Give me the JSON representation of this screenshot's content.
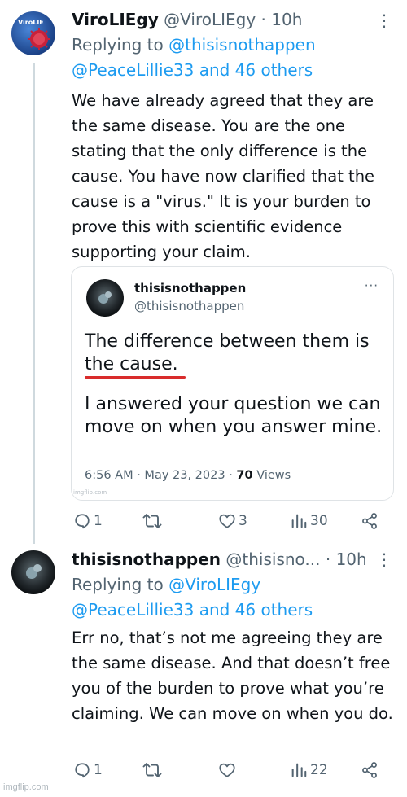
{
  "tweet1": {
    "name": "ViroLIEgy",
    "handle": "@ViroLIEgy",
    "time": "· 10h",
    "avatar_text": "ViroLIE",
    "replying_prefix": "Replying to ",
    "replying_user": "@thisisnothappen",
    "replying_rest": "@PeaceLillie33 and 46 others",
    "body": "We have already agreed that they are the same disease. You are the one stating that the only difference is the cause. You have now clarified that the cause is a \"virus.\" It is your burden to prove this with scientific evidence supporting your claim.",
    "quote": {
      "name": "thisisnothappen",
      "handle": "@thisisnothappen",
      "more": "···",
      "text1": "The difference between them is the cause.",
      "text2": "I answered your question we can move on when you answer mine.",
      "time": "6:56 AM · May 23, 2023 · ",
      "views": "70",
      "views_label": " Views",
      "watermark": "imgflip.com"
    },
    "actions": {
      "replies": "1",
      "retweets": "",
      "likes": "3",
      "views": "30"
    }
  },
  "tweet2": {
    "name": "thisisnothappen",
    "handle": "@thisisno...",
    "time": "· 10h",
    "replying_prefix": "Replying to ",
    "replying_user": "@ViroLIEgy",
    "replying_rest": "@PeaceLillie33 and 46 others",
    "body": "Err no, that’s not me agreeing they are the same disease. And that doesn’t free you of the burden to prove what you’re claiming. We can move on when you do.",
    "actions": {
      "replies": "1",
      "retweets": "",
      "likes": "",
      "views": "22"
    }
  },
  "more_label": "⋮",
  "watermark": "imgflip.com",
  "colors": {
    "link": "#1d9bf0",
    "muted": "#536471",
    "underline": "#d92c2c"
  },
  "icons": [
    "reply-icon",
    "retweet-icon",
    "like-icon",
    "views-icon",
    "share-icon",
    "more-icon"
  ]
}
